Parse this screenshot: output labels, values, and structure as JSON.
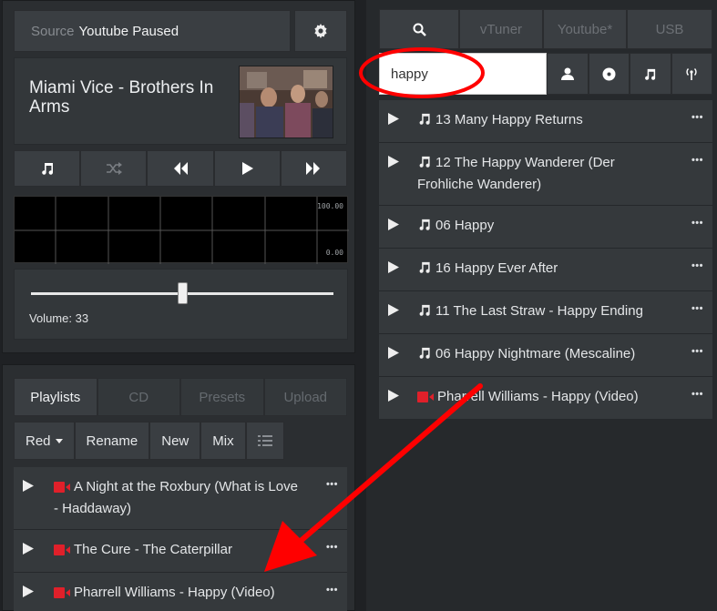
{
  "player": {
    "source_label": "Source",
    "source_value": "Youtube Paused",
    "settings_icon": "gear-icon",
    "track_title": "Miami Vice - Brothers In Arms",
    "transport": [
      "music-note-icon",
      "shuffle-icon",
      "rewind-icon",
      "play-icon",
      "fast-forward-icon"
    ],
    "spectrum_max": "100.00",
    "spectrum_min": "0.00",
    "volume_label": "Volume: 33",
    "volume_level": 0.5
  },
  "library": {
    "tabs": [
      "Playlists",
      "CD",
      "Presets",
      "Upload"
    ],
    "active_tab": "Playlists",
    "playlist_select": "Red",
    "actions": [
      "Rename",
      "New",
      "Mix"
    ],
    "list_icon": "list-icon",
    "items": [
      {
        "type": "video",
        "title": "A Night at the Roxbury (What is Love - Haddaway)"
      },
      {
        "type": "video",
        "title": "The Cure - The Caterpillar"
      },
      {
        "type": "video",
        "title": "Pharrell Williams - Happy (Video)"
      }
    ]
  },
  "search": {
    "source_tabs": [
      "vTuner",
      "Youtube*",
      "USB"
    ],
    "search_icon": "search-icon",
    "query": "happy",
    "filter_icons": [
      "artist-icon",
      "album-icon",
      "track-icon",
      "radio-icon"
    ],
    "results": [
      {
        "type": "track",
        "title": "13 Many Happy Returns"
      },
      {
        "type": "track",
        "title": "12 The Happy Wanderer (Der Frohliche Wanderer)"
      },
      {
        "type": "track",
        "title": "06 Happy"
      },
      {
        "type": "track",
        "title": "16 Happy Ever After"
      },
      {
        "type": "track",
        "title": "11 The Last Straw - Happy Ending"
      },
      {
        "type": "track",
        "title": "06 Happy Nightmare (Mescaline)"
      },
      {
        "type": "video",
        "title": "Pharrell Williams - Happy (Video)"
      }
    ]
  },
  "colors": {
    "background": "#1f2124",
    "button": "#3a3e42",
    "list_item": "#35393c",
    "video_icon": "#e0202a",
    "annotation": "#ff0000"
  }
}
